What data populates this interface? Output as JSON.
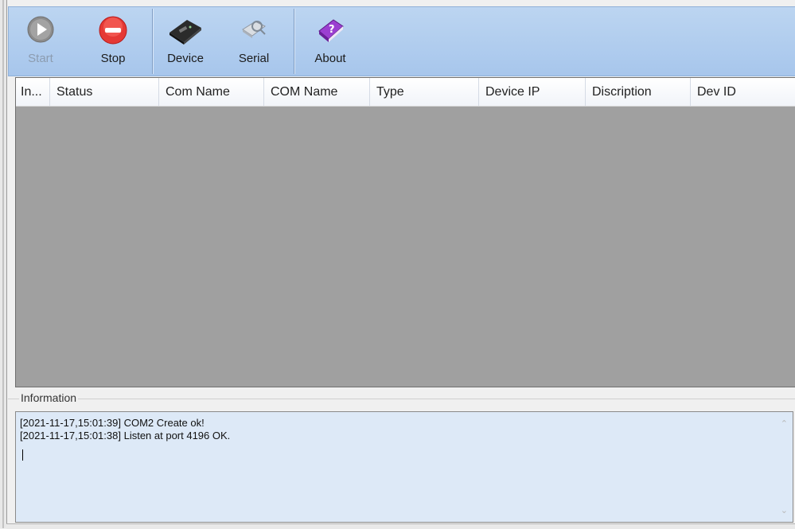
{
  "toolbar": {
    "buttons": [
      {
        "label": "Start",
        "icon": "play-icon",
        "enabled": false
      },
      {
        "label": "Stop",
        "icon": "stop-icon",
        "enabled": true
      },
      {
        "label": "Device",
        "icon": "device-icon",
        "enabled": true
      },
      {
        "label": "Serial",
        "icon": "serial-icon",
        "enabled": true
      },
      {
        "label": "About",
        "icon": "help-book-icon",
        "enabled": true
      }
    ]
  },
  "table": {
    "columns": [
      "In...",
      "Status",
      "Com Name",
      "COM Name",
      "Type",
      "Device IP",
      "Discription",
      "Dev ID"
    ],
    "rows": []
  },
  "information": {
    "title": "Information",
    "log": [
      "[2021-11-17,15:01:39] COM2 Create ok!",
      "[2021-11-17,15:01:38] Listen at port 4196 OK."
    ]
  },
  "colors": {
    "toolbar": "#b1cdef",
    "list_background": "#a0a0a0",
    "log_background": "#dde9f7",
    "stop_red": "#e53935"
  }
}
